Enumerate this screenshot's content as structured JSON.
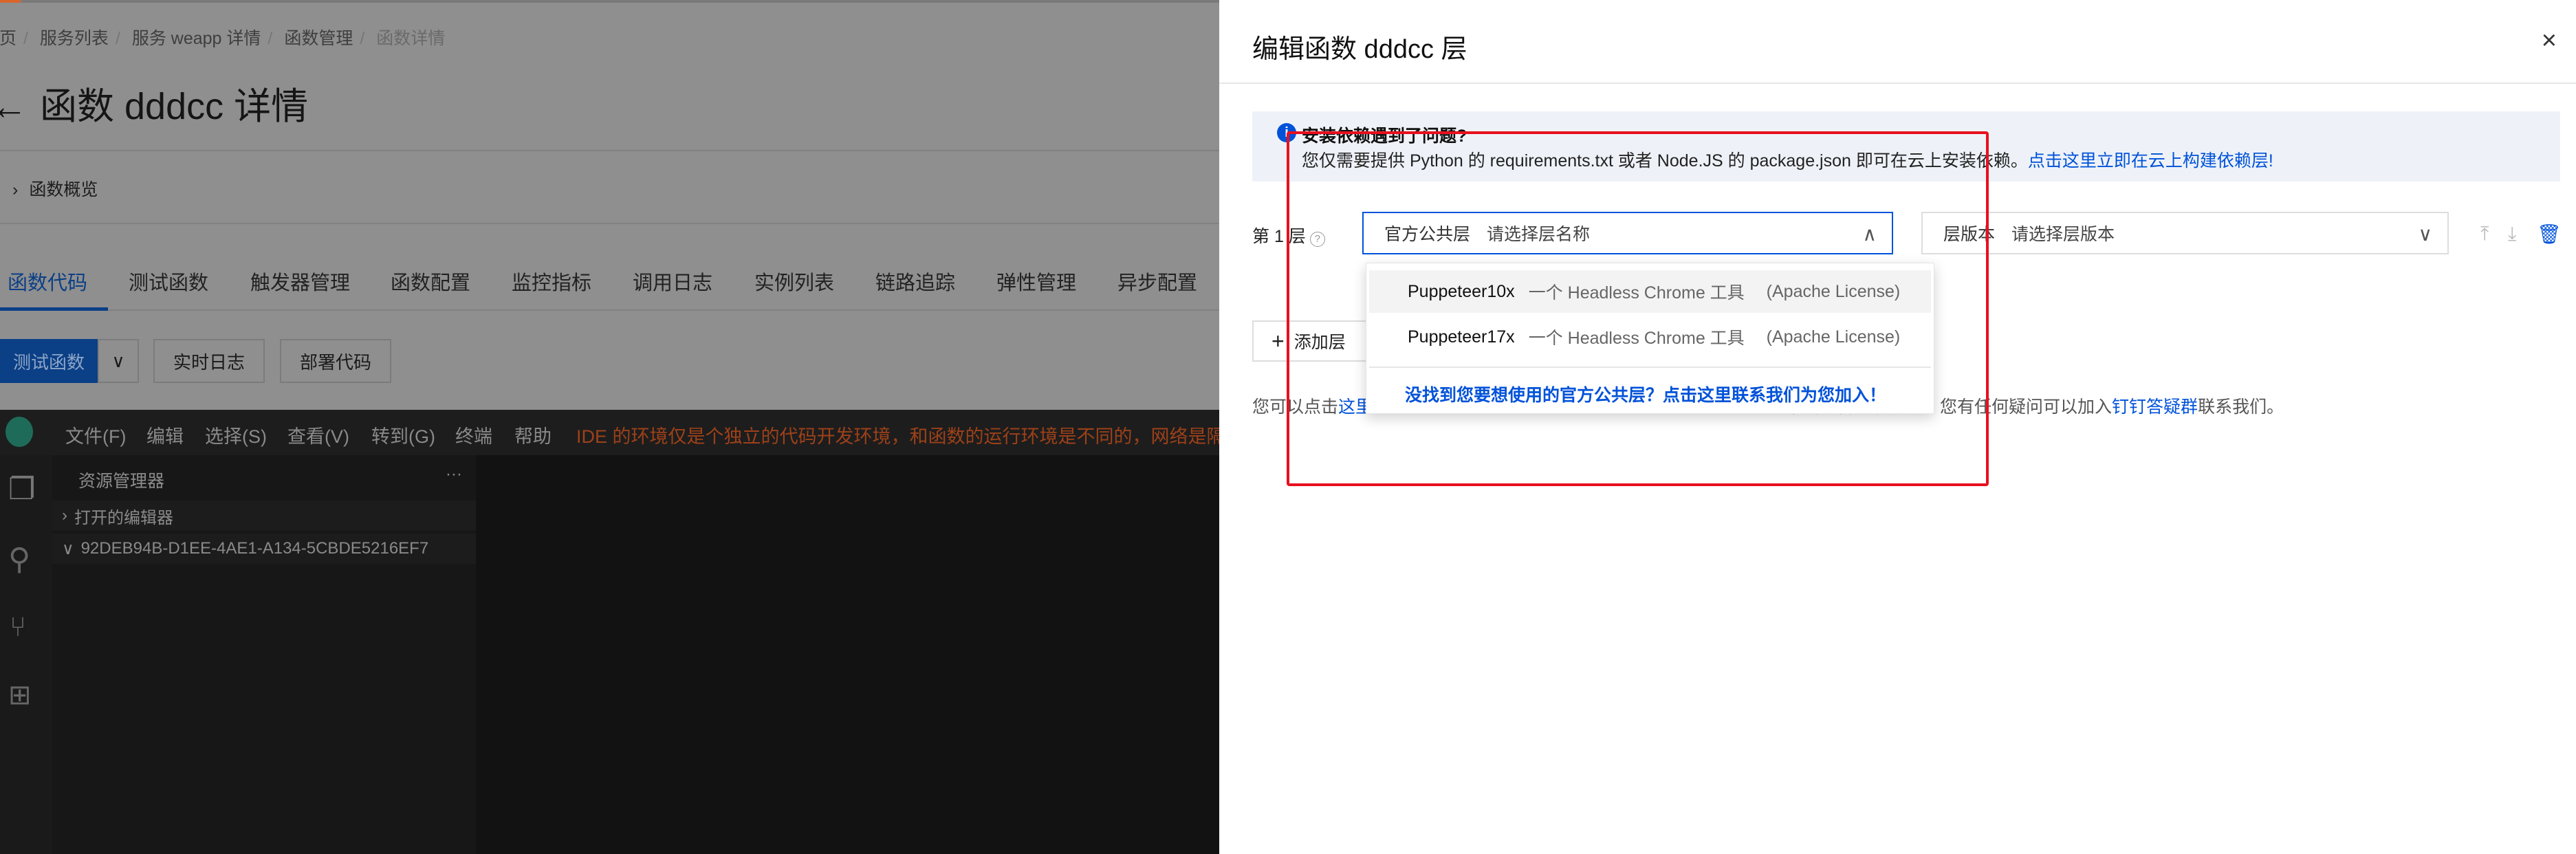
{
  "breadcrumb": [
    "首页",
    "服务列表",
    "服务 weapp 详情",
    "函数管理",
    "函数详情"
  ],
  "page_title": "函数 dddcc 详情",
  "overview": "函数概览",
  "tabs": [
    "函数代码",
    "测试函数",
    "触发器管理",
    "函数配置",
    "监控指标",
    "调用日志",
    "实例列表",
    "链路追踪",
    "弹性管理",
    "异步配置"
  ],
  "buttons": {
    "test": "测试函数",
    "logs": "实时日志",
    "deploy": "部署代码"
  },
  "ide": {
    "menu": [
      "文件(F)",
      "编辑",
      "选择(S)",
      "查看(V)",
      "转到(G)",
      "终端",
      "帮助"
    ],
    "warning": "IDE 的环境仅是个独立的代码开发环境，和函数的运行环境是不同的，网络是隔离开的。",
    "explorer": "资源管理器",
    "more": "···",
    "open_editors": "打开的编辑器",
    "folder": "92DEB94B-D1EE-4AE1-A134-5CBDE5216EF7"
  },
  "drawer": {
    "title": "编辑函数 dddcc 层",
    "close": "×",
    "info_title": "安装依赖遇到了问题?",
    "info_text": "您仅需要提供 Python 的 requirements.txt 或者 Node.JS 的 package.json 即可在云上安装依赖。",
    "info_link": "点击这里立即在云上构建依赖层!",
    "layer_label": "第 1 层",
    "select_prefix": "官方公共层",
    "select_placeholder": "请选择层名称",
    "version_prefix": "层版本",
    "version_placeholder": "请选择层版本",
    "options": [
      {
        "name": "Puppeteer10x",
        "desc": "一个 Headless Chrome 工具",
        "license": "(Apache License)"
      },
      {
        "name": "Puppeteer17x",
        "desc": "一个 Headless Chrome 工具",
        "license": "(Apache License)"
      }
    ],
    "not_found": "没找到您要想使用的官方公共层？点击这里联系我们为您加入！",
    "add_layer": "添加层",
    "note_pre": "您可以点击",
    "note_link1": "这里",
    "note_mid": "中层是否挂载成功。您有任何疑问可以加入",
    "note_link2": "钉钉答疑群",
    "note_post": "联系我们。"
  },
  "colors": {
    "accent": "#0052d9",
    "highlight": "#e8101f",
    "warning": "#9d4119"
  }
}
